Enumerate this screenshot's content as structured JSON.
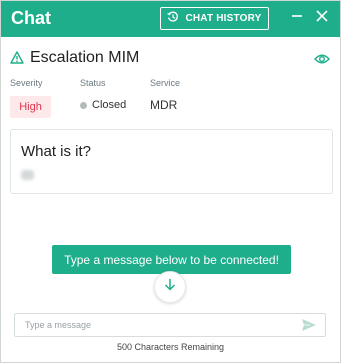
{
  "header": {
    "title": "Chat",
    "history_button": "CHAT HISTORY"
  },
  "incident": {
    "title": "Escalation MIM",
    "severity_label": "Severity",
    "status_label": "Status",
    "service_label": "Service",
    "severity": "High",
    "status": "Closed",
    "service": "MDR"
  },
  "info_card": {
    "title": "What is it?"
  },
  "banner": {
    "text": "Type a message below to be connected!"
  },
  "composer": {
    "placeholder": "Type a message",
    "value": "",
    "remaining": "500 Characters Remaining"
  },
  "colors": {
    "accent": "#1fae8b",
    "severity_high": "#e0344e",
    "status_closed": "#b5babd"
  },
  "icons": {
    "history": "history-icon",
    "minimize": "minimize-icon",
    "close": "close-icon",
    "warning": "warning-triangle-icon",
    "visibility": "eye-icon",
    "scroll_down": "arrow-down-icon",
    "send": "send-icon"
  }
}
